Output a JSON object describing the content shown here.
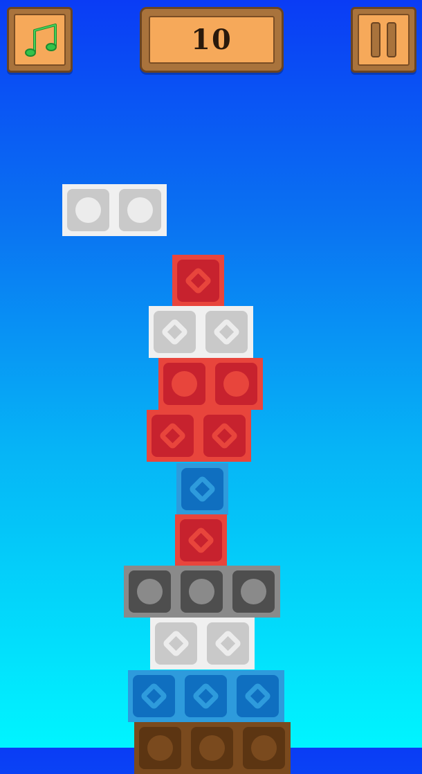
{
  "score": "10",
  "icons": {
    "music": "music-note-icon",
    "pause": "pause-icon"
  },
  "colors": {
    "red": "#e8453c",
    "white": "#f0f0f0",
    "blue": "#2e9bdc",
    "gray": "#8a8a8a",
    "brown": "#7a4a1e"
  },
  "tower": [
    {
      "name": "falling-block",
      "color": "white",
      "cells": 2,
      "mark": "circle"
    },
    {
      "name": "tower-block-1",
      "color": "red",
      "cells": 1,
      "mark": "diamond"
    },
    {
      "name": "tower-block-2",
      "color": "white",
      "cells": 2,
      "mark": "diamond"
    },
    {
      "name": "tower-block-3",
      "color": "red",
      "cells": 2,
      "mark": "circle"
    },
    {
      "name": "tower-block-4",
      "color": "red",
      "cells": 2,
      "mark": "diamond"
    },
    {
      "name": "tower-block-5",
      "color": "blue",
      "cells": 1,
      "mark": "diamond"
    },
    {
      "name": "tower-block-6",
      "color": "red",
      "cells": 1,
      "mark": "diamond"
    },
    {
      "name": "tower-block-7",
      "color": "gray",
      "cells": 3,
      "mark": "circle"
    },
    {
      "name": "tower-block-8",
      "color": "white",
      "cells": 2,
      "mark": "diamond"
    },
    {
      "name": "tower-block-9",
      "color": "blue",
      "cells": 3,
      "mark": "diamond"
    },
    {
      "name": "tower-block-10",
      "color": "brown",
      "cells": 3,
      "mark": "circle"
    }
  ]
}
